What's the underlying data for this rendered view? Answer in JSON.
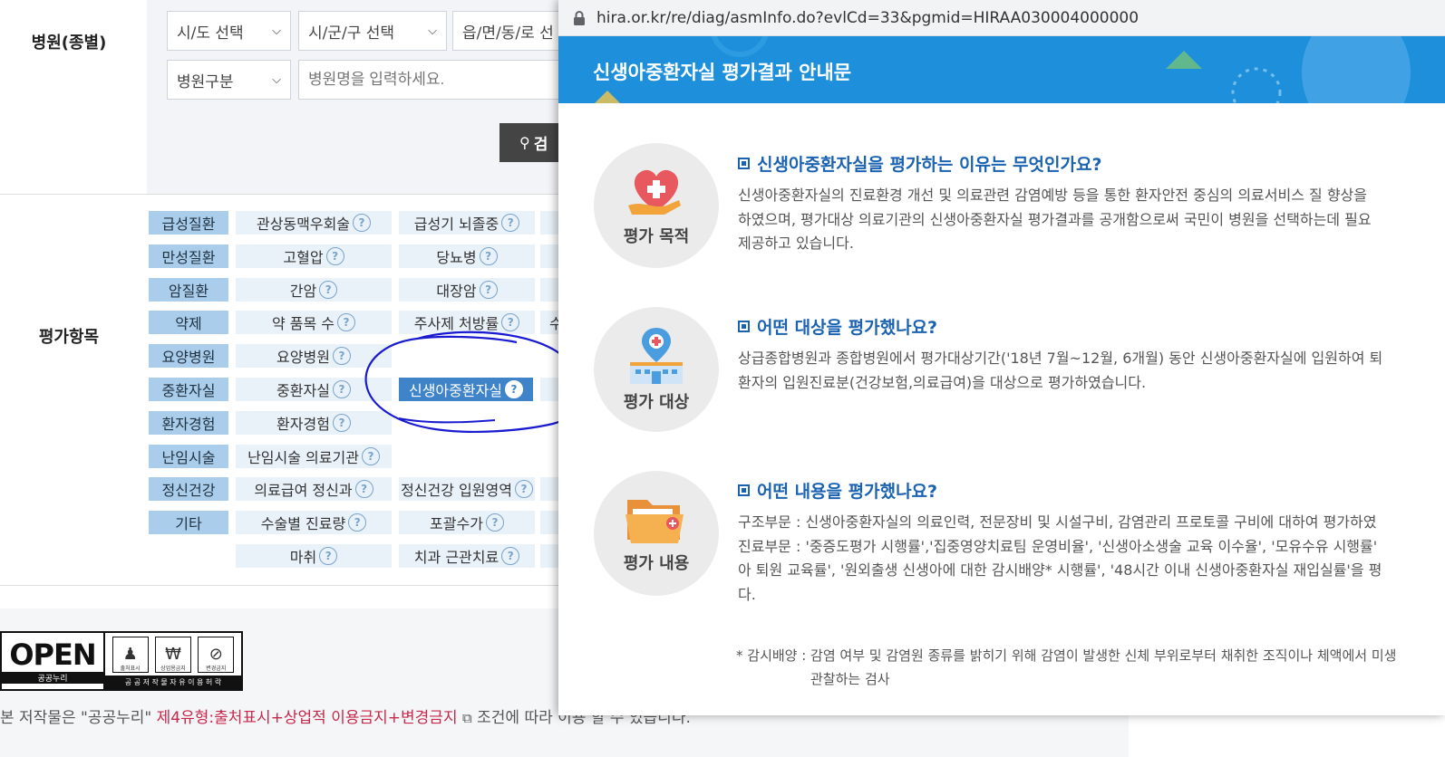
{
  "search": {
    "hospital_label": "병원(종별)",
    "sido_select": "시/도 선택",
    "sigungu_select": "시/군/구 선택",
    "dong_select": "읍/면/동/로 선",
    "hospital_type_select": "병원구분",
    "name_placeholder": "병원명을 입력하세요.",
    "search_button": "검"
  },
  "eval": {
    "label": "평가항목",
    "rows": [
      {
        "category": "급성질환",
        "items": [
          "관상동맥우회술",
          "급성기 뇌졸중"
        ]
      },
      {
        "category": "만성질환",
        "items": [
          "고혈압",
          "당뇨병"
        ]
      },
      {
        "category": "암질환",
        "items": [
          "간암",
          "대장암"
        ]
      },
      {
        "category": "약제",
        "items": [
          "약 품목 수",
          "주사제 처방률"
        ],
        "extra": "수"
      },
      {
        "category": "요양병원",
        "items": [
          "요양병원"
        ]
      },
      {
        "category": "중환자실",
        "items": [
          "중환자실",
          "신생아중환자실"
        ]
      },
      {
        "category": "환자경험",
        "items": [
          "환자경험"
        ]
      },
      {
        "category": "난임시술",
        "items": [
          "난임시술 의료기관"
        ]
      },
      {
        "category": "정신건강",
        "items": [
          "의료급여 정신과",
          "정신건강 입원영역"
        ]
      },
      {
        "category": "기타",
        "items": [
          "수술별 진료량",
          "포괄수가"
        ]
      },
      {
        "category": "",
        "items": [
          "마취",
          "치과 근관치료"
        ]
      }
    ]
  },
  "footer": {
    "open_text": "OPEN",
    "open_sub": "공공누리",
    "open_caption": "공 공 저 작 물  자 유 이 용 허 락",
    "open_icons": [
      "출처표시",
      "상업용금지",
      "변경금지"
    ],
    "license_prefix": "본 저작물은 \"공공누리\"",
    "license_link": "제4유형:출처표시+상업적 이용금지+변경금지",
    "license_suffix": "조건에 따라 이용 할 수 있습니다."
  },
  "popup": {
    "url": "hira.or.kr/re/diag/asmInfo.do?evlCd=33&pgmid=HIRAA030004000000",
    "title": "신생아중환자실 평가결과 안내문",
    "sections": [
      {
        "icon": "heart-hand-icon",
        "icon_label": "평가 목적",
        "question": "신생아중환자실을 평가하는 이유는 무엇인가요?",
        "lines": [
          "신생아중환자실의 진료환경 개선 및 의료관련 감염예방 등을 통한 환자안전 중심의 의료서비스 질 향상을",
          "하였으며, 평가대상 의료기관의 신생아중환자실 평가결과를 공개함으로써 국민이 병원을 선택하는데 필요",
          "제공하고 있습니다."
        ]
      },
      {
        "icon": "hospital-pin-icon",
        "icon_label": "평가 대상",
        "question": "어떤 대상을 평가했나요?",
        "lines": [
          "상급종합병원과 종합병원에서 평가대상기간('18년 7월~12월, 6개월) 동안 신생아중환자실에 입원하여 퇴",
          "환자의 입원진료분(건강보험,의료급여)을 대상으로 평가하였습니다."
        ]
      },
      {
        "icon": "folder-icon",
        "icon_label": "평가 내용",
        "question": "어떤 내용을 평가했나요?",
        "lines": [
          "구조부문 : 신생아중환자실의 의료인력, 전문장비 및 시설구비, 감염관리 프로토콜 구비에 대하여 평가하였",
          "진료부문 : '중증도평가 시행률','집중영양치료팀 운영비율', '신생아소생술 교육 이수율', '모유수유 시행률'",
          "아 퇴원 교육률', '원외출생 신생아에 대한 감시배양* 시행률', '48시간 이내 신생아중환자실 재입실률'을 평",
          "다."
        ]
      }
    ],
    "note_line1": "* 감시배양 : 감염 여부 및 감염원 종류를 밝히기 위해 감염이 발생한 신체 부위로부터 채취한 조직이나 체액에서 미생",
    "note_line2": "관찰하는 검사"
  },
  "colors": {
    "accent_blue": "#1e8fdb",
    "category_bg": "#a9cdea",
    "item_bg": "#e9f1f9",
    "active_item": "#3f83c8",
    "annotation_ink": "#1a1ad0",
    "license_link": "#c8284a"
  }
}
